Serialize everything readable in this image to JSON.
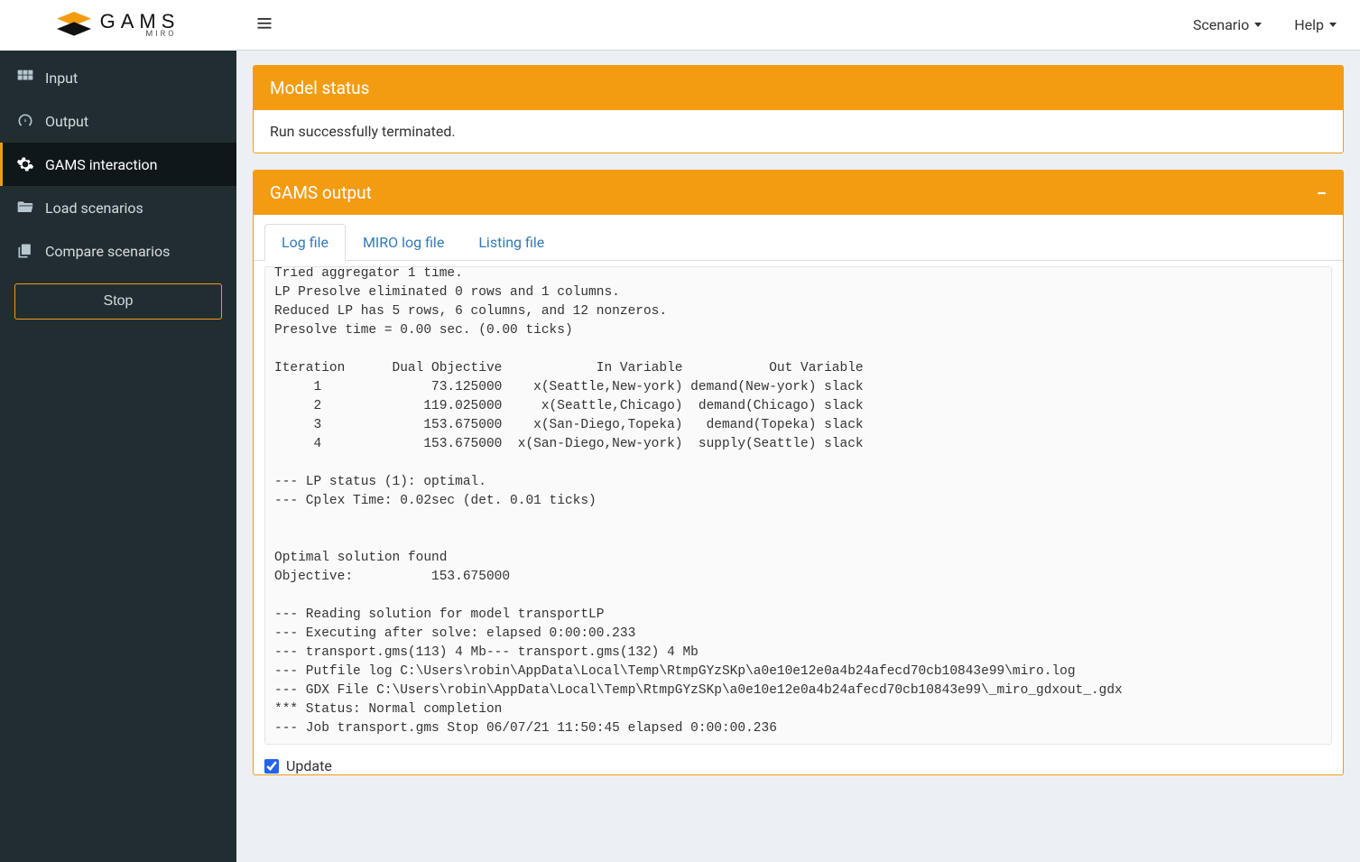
{
  "logo": {
    "brand": "GAMS",
    "sub": "MIRO"
  },
  "topbar": {
    "scenario_label": "Scenario",
    "help_label": "Help"
  },
  "sidebar": {
    "items": [
      {
        "label": "Input",
        "icon": "grid-icon"
      },
      {
        "label": "Output",
        "icon": "gauge-icon"
      },
      {
        "label": "GAMS interaction",
        "icon": "gear-icon"
      },
      {
        "label": "Load scenarios",
        "icon": "folder-open-icon"
      },
      {
        "label": "Compare scenarios",
        "icon": "copy-icon"
      }
    ],
    "active_index": 2,
    "stop_label": "Stop"
  },
  "status_panel": {
    "title": "Model status",
    "body": "Run successfully terminated."
  },
  "output_panel": {
    "title": "GAMS output",
    "tabs": [
      {
        "label": "Log file"
      },
      {
        "label": "MIRO log file"
      },
      {
        "label": "Listing file"
      }
    ],
    "active_tab": 0,
    "log_text": "Tried aggregator 1 time.\nLP Presolve eliminated 0 rows and 1 columns.\nReduced LP has 5 rows, 6 columns, and 12 nonzeros.\nPresolve time = 0.00 sec. (0.00 ticks)\n\nIteration      Dual Objective            In Variable           Out Variable\n     1              73.125000    x(Seattle,New-york) demand(New-york) slack\n     2             119.025000     x(Seattle,Chicago)  demand(Chicago) slack\n     3             153.675000    x(San-Diego,Topeka)   demand(Topeka) slack\n     4             153.675000  x(San-Diego,New-york)  supply(Seattle) slack\n\n--- LP status (1): optimal.\n--- Cplex Time: 0.02sec (det. 0.01 ticks)\n\n\nOptimal solution found\nObjective:          153.675000\n\n--- Reading solution for model transportLP\n--- Executing after solve: elapsed 0:00:00.233\n--- transport.gms(113) 4 Mb--- transport.gms(132) 4 Mb\n--- Putfile log C:\\Users\\robin\\AppData\\Local\\Temp\\RtmpGYzSKp\\a0e10e12e0a4b24afecd70cb10843e99\\miro.log\n--- GDX File C:\\Users\\robin\\AppData\\Local\\Temp\\RtmpGYzSKp\\a0e10e12e0a4b24afecd70cb10843e99\\_miro_gdxout_.gdx\n*** Status: Normal completion\n--- Job transport.gms Stop 06/07/21 11:50:45 elapsed 0:00:00.236",
    "update_label": "Update",
    "update_checked": true
  }
}
